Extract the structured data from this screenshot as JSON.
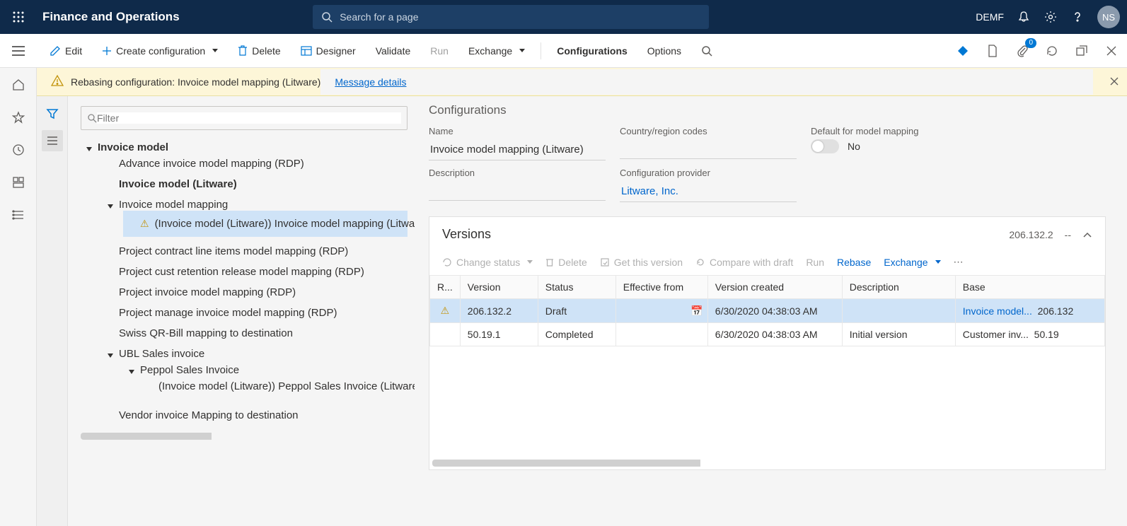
{
  "topbar": {
    "title": "Finance and Operations",
    "search_placeholder": "Search for a page",
    "company": "DEMF",
    "avatar": "NS"
  },
  "actions": {
    "edit": "Edit",
    "create": "Create configuration",
    "delete": "Delete",
    "designer": "Designer",
    "validate": "Validate",
    "run": "Run",
    "exchange": "Exchange",
    "configurations": "Configurations",
    "options": "Options",
    "badge_count": "0"
  },
  "notif": {
    "message": "Rebasing configuration: Invoice model mapping (Litware)",
    "details": "Message details"
  },
  "filter_placeholder": "Filter",
  "tree": {
    "root": "Invoice model",
    "n1": "Advance invoice model mapping (RDP)",
    "n2": "Invoice model (Litware)",
    "n3": "Invoice model mapping",
    "n3a": "(Invoice model (Litware)) Invoice model mapping (Litware)",
    "n4": "Project contract line items model mapping (RDP)",
    "n5": "Project cust retention release model mapping (RDP)",
    "n6": "Project invoice model mapping (RDP)",
    "n7": "Project manage invoice model mapping (RDP)",
    "n8": "Swiss QR-Bill mapping to destination",
    "n9": "UBL Sales invoice",
    "n9a": "Peppol Sales Invoice",
    "n9a1": "(Invoice model (Litware)) Peppol Sales Invoice (Litware)",
    "n10": "Vendor invoice Mapping to destination"
  },
  "config": {
    "heading": "Configurations",
    "name_label": "Name",
    "name_value": "Invoice model mapping (Litware)",
    "country_label": "Country/region codes",
    "country_value": "",
    "default_label": "Default for model mapping",
    "default_value": "No",
    "description_label": "Description",
    "description_value": "",
    "provider_label": "Configuration provider",
    "provider_value": "Litware, Inc."
  },
  "versions": {
    "title": "Versions",
    "header_version": "206.132.2",
    "header_dash": "--",
    "tools": {
      "change_status": "Change status",
      "delete": "Delete",
      "get": "Get this version",
      "compare": "Compare with draft",
      "run": "Run",
      "rebase": "Rebase",
      "exchange": "Exchange"
    },
    "columns": {
      "r": "R...",
      "version": "Version",
      "status": "Status",
      "effective": "Effective from",
      "created": "Version created",
      "description": "Description",
      "base": "Base"
    },
    "rows": [
      {
        "warn": true,
        "version": "206.132.2",
        "status": "Draft",
        "effective": "",
        "created": "6/30/2020 04:38:03 AM",
        "description": "",
        "base": "Invoice model...",
        "base2": "206.132"
      },
      {
        "warn": false,
        "version": "50.19.1",
        "status": "Completed",
        "effective": "",
        "created": "6/30/2020 04:38:03 AM",
        "description": "Initial version",
        "base": "Customer inv...",
        "base2": "50.19"
      }
    ]
  }
}
